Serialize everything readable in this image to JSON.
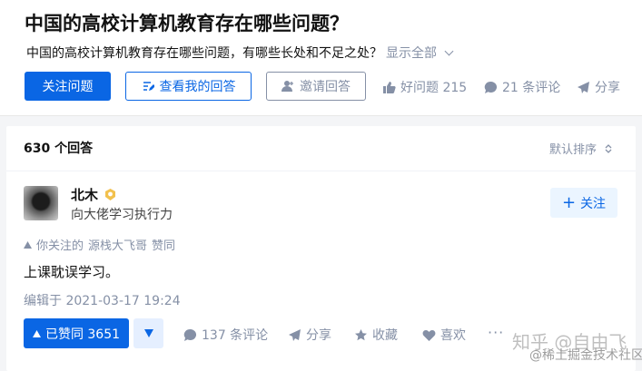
{
  "question": {
    "title": "中国的高校计算机教育存在哪些问题？",
    "detail": "中国的高校计算机教育存在哪些问题，有哪些长处和不足之处？",
    "show_all": "显示全部"
  },
  "actions": {
    "follow_question": "关注问题",
    "view_my_answer": "查看我的回答",
    "invite_answer": "邀请回答",
    "good_question": "好问题 215",
    "comments": "21 条评论",
    "share": "分享"
  },
  "answers": {
    "count_label": "630 个回答",
    "sort_label": "默认排序"
  },
  "answer": {
    "author": "北木",
    "headline": "向大佬学习执行力",
    "follow_button": "关注",
    "social_prefix": "你关注的",
    "social_user": "源栈大飞哥",
    "social_action": "赞同",
    "content": "上课耽误学习。",
    "edited": "编辑于 2021-03-17 19:24",
    "upvote": "已赞同 3651",
    "comments": "137 条评论",
    "share": "分享",
    "collect": "收藏",
    "like": "喜欢",
    "more": "···"
  },
  "watermark": {
    "line1": "知乎 @自由飞",
    "line2": "@稀土掘金技术社区"
  },
  "colors": {
    "primary": "#0a66e4",
    "muted": "#8590a6",
    "text": "#121212",
    "background": "#f4f5f7"
  }
}
